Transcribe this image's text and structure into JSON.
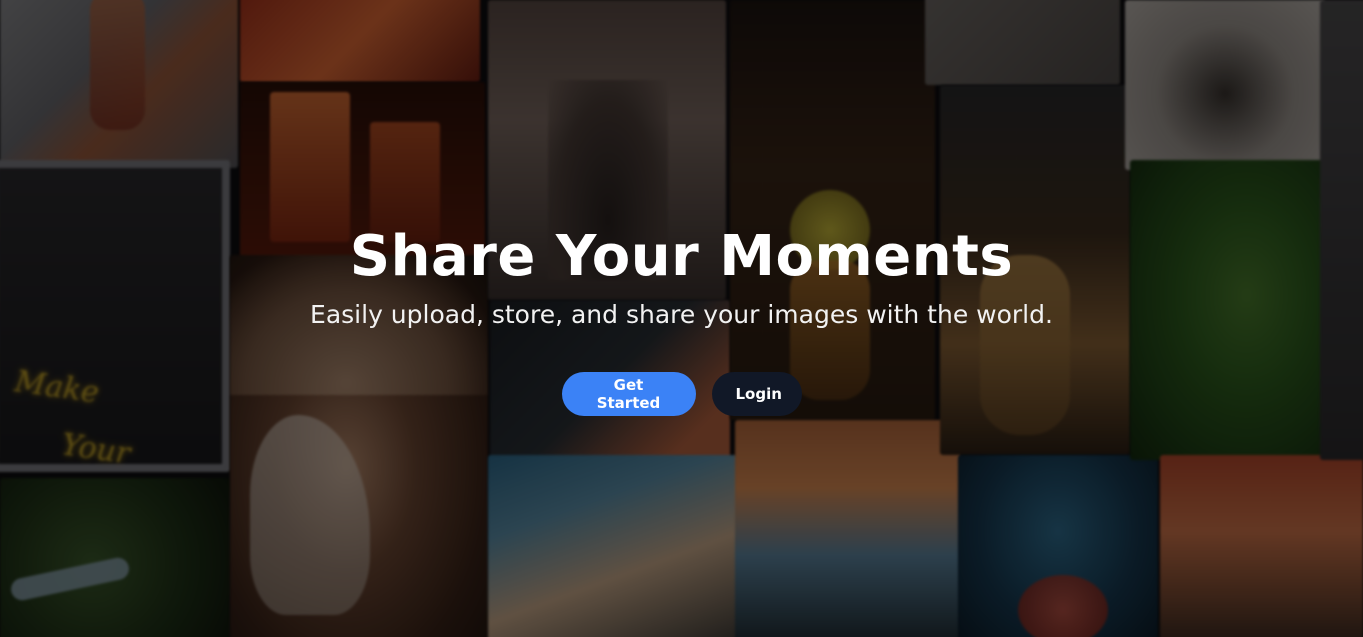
{
  "hero": {
    "title": "Share Your Moments",
    "subtitle": "Easily upload, store, and share your images with the world.",
    "background": "blurred photo collage",
    "overlay_color": "#000000"
  },
  "actions": {
    "get_started_label": "Get Started",
    "login_label": "Login"
  },
  "colors": {
    "primary_button": "#3b82f6",
    "secondary_button": "#111827",
    "text": "#ffffff"
  }
}
